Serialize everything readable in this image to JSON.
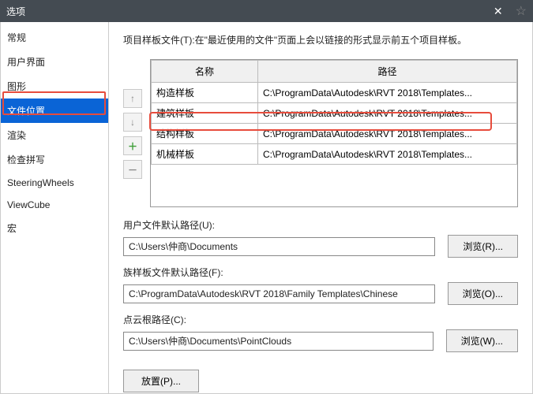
{
  "title": "选项",
  "sidebar": {
    "items": [
      {
        "label": "常规"
      },
      {
        "label": "用户界面"
      },
      {
        "label": "图形"
      },
      {
        "label": "文件位置"
      },
      {
        "label": "渲染"
      },
      {
        "label": "检查拼写"
      },
      {
        "label": "SteeringWheels"
      },
      {
        "label": "ViewCube"
      },
      {
        "label": "宏"
      }
    ],
    "selected_index": 3
  },
  "description": "项目样板文件(T):在\"最近使用的文件\"页面上会以链接的形式显示前五个项目样板。",
  "table": {
    "headers": {
      "name": "名称",
      "path": "路径"
    },
    "rows": [
      {
        "name": "构造样板",
        "path": "C:\\ProgramData\\Autodesk\\RVT 2018\\Templates..."
      },
      {
        "name": "建筑样板",
        "path": "C:\\ProgramData\\Autodesk\\RVT 2018\\Templates..."
      },
      {
        "name": "结构样板",
        "path": "C:\\ProgramData\\Autodesk\\RVT 2018\\Templates..."
      },
      {
        "name": "机械样板",
        "path": "C:\\ProgramData\\Autodesk\\RVT 2018\\Templates..."
      }
    ],
    "highlighted_row_index": 2
  },
  "side_buttons": {
    "up": "↑",
    "down": "↓",
    "add": "＋",
    "remove": "－"
  },
  "fields": {
    "user_files": {
      "label": "用户文件默认路径(U):",
      "value": "C:\\Users\\仲商\\Documents",
      "browse": "浏览(R)..."
    },
    "family_templates": {
      "label": "族样板文件默认路径(F):",
      "value": "C:\\ProgramData\\Autodesk\\RVT 2018\\Family Templates\\Chinese",
      "browse": "浏览(O)..."
    },
    "point_cloud": {
      "label": "点云根路径(C):",
      "value": "C:\\Users\\仲商\\Documents\\PointClouds",
      "browse": "浏览(W)..."
    }
  },
  "places_button": "放置(P)...",
  "star_icon": "☆"
}
